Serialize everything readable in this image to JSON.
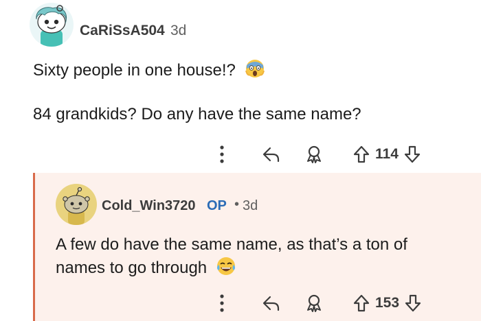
{
  "comment": {
    "username": "CaRiSsA504",
    "time": "3d",
    "line1": "Sixty people in one house!?",
    "line2": "84 grandkids? Do any have the same name?",
    "score": "114",
    "emoji": "screaming-face-icon"
  },
  "reply": {
    "username": "Cold_Win3720",
    "op_badge": "OP",
    "separator": "•",
    "time": "3d",
    "line1": "A few do have the same name, as that’s a ton of",
    "line2": "names to go through",
    "score": "153",
    "emoji": "laughing-tears-icon"
  },
  "colors": {
    "op_blue": "#2b6cb6",
    "reply_bg": "#fdf1ec",
    "thread_line": "#d96a4a"
  }
}
